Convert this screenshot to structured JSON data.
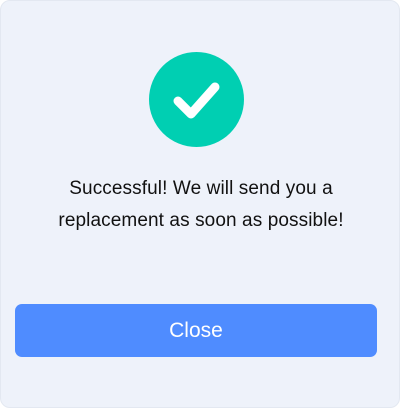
{
  "dialog": {
    "icon": "checkmark-circle-icon",
    "message_line_1": "Successful! We will send you a",
    "message_line_2": "replacement as soon as possible!",
    "close_label": "Close"
  },
  "colors": {
    "background": "#eef2fa",
    "success": "#00cfb2",
    "accent": "#4f8cff",
    "text": "#111111"
  }
}
